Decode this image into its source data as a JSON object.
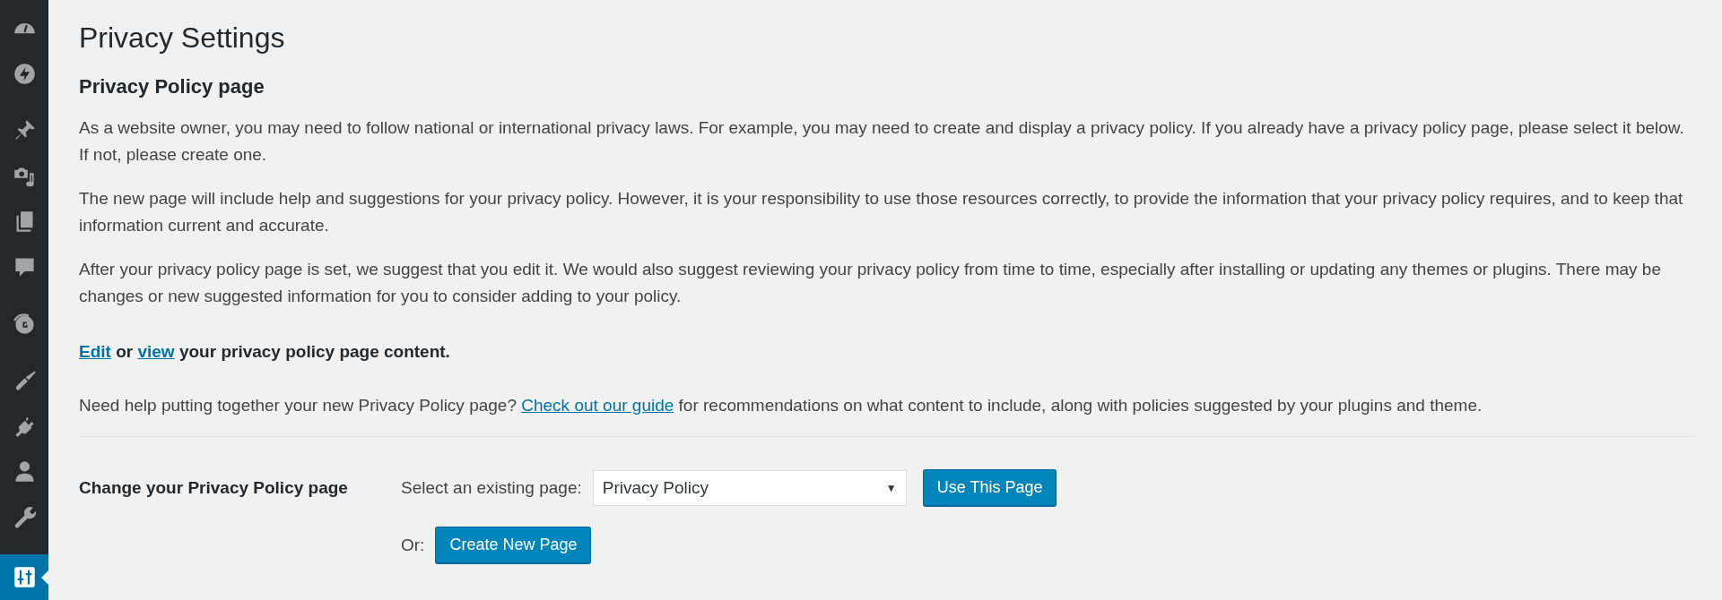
{
  "sidebar": {
    "items": [
      {
        "kind": "gauge",
        "selected": false
      },
      {
        "kind": "bolt",
        "selected": false
      },
      {
        "kind": "pin",
        "selected": false
      },
      {
        "kind": "media",
        "selected": false
      },
      {
        "kind": "pages",
        "selected": false
      },
      {
        "kind": "comment",
        "selected": false
      },
      {
        "kind": "globe",
        "selected": false
      },
      {
        "kind": "brush",
        "selected": false
      },
      {
        "kind": "plug",
        "selected": false
      },
      {
        "kind": "user",
        "selected": false
      },
      {
        "kind": "wrench",
        "selected": false
      },
      {
        "kind": "sliders",
        "selected": true
      }
    ]
  },
  "title": "Privacy Settings",
  "section_heading": "Privacy Policy page",
  "paragraphs": [
    "As a website owner, you may need to follow national or international privacy laws. For example, you may need to create and display a privacy policy. If you already have a privacy policy page, please select it below. If not, please create one.",
    "The new page will include help and suggestions for your privacy policy. However, it is your responsibility to use those resources correctly, to provide the information that your privacy policy requires, and to keep that information current and accurate.",
    "After your privacy policy page is set, we suggest that you edit it. We would also suggest reviewing your privacy policy from time to time, especially after installing or updating any themes or plugins. There may be changes or new suggested information for you to consider adding to your policy."
  ],
  "edit_line": [
    {
      "kind": "link",
      "text": "Edit"
    },
    {
      "kind": "text",
      "text": " or "
    },
    {
      "kind": "link",
      "text": "view"
    },
    {
      "kind": "text",
      "text": " your privacy policy page content."
    }
  ],
  "help_line": [
    {
      "kind": "text",
      "text": "Need help putting together your new Privacy Policy page? "
    },
    {
      "kind": "link",
      "text": "Check out our guide"
    },
    {
      "kind": "text",
      "text": " for recommendations on what content to include, along with policies suggested by your plugins and theme."
    }
  ],
  "form": {
    "label": "Change your Privacy Policy page",
    "select_label": "Select an existing page:",
    "select_value": "Privacy Policy",
    "select_arrow": "▼",
    "use_button": "Use This Page",
    "or_label": "Or:",
    "create_button": "Create New Page"
  }
}
